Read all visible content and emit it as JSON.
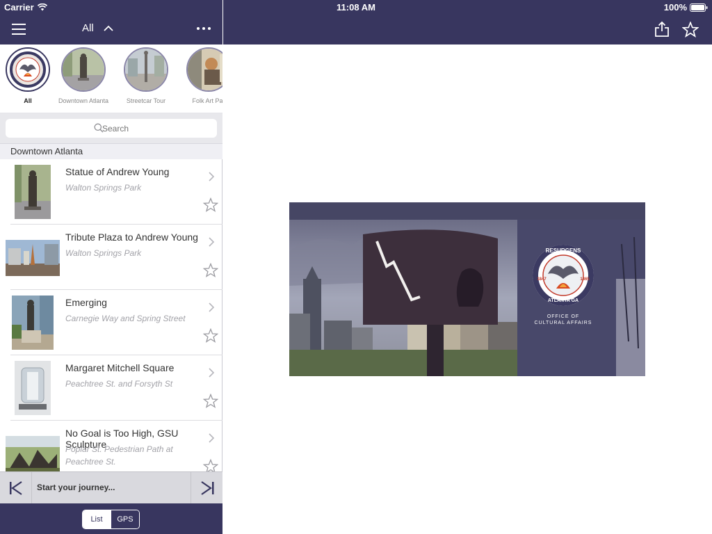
{
  "status": {
    "carrier": "Carrier",
    "time": "11:08 AM",
    "battery": "100%"
  },
  "nav": {
    "filter_label": "All"
  },
  "tours": [
    {
      "label": "All"
    },
    {
      "label": "Downtown Atlanta"
    },
    {
      "label": "Streetcar Tour"
    },
    {
      "label": "Folk Art Par"
    }
  ],
  "search": {
    "placeholder": "Search"
  },
  "section": {
    "title": "Downtown Atlanta"
  },
  "items": [
    {
      "title": "Statue of Andrew Young",
      "subtitle": "Walton Springs Park"
    },
    {
      "title": "Tribute Plaza to Andrew Young",
      "subtitle": "Walton Springs Park"
    },
    {
      "title": "Emerging",
      "subtitle": "Carnegie Way and Spring Street"
    },
    {
      "title": "Margaret Mitchell Square",
      "subtitle": "Peachtree St.  and Forsyth St"
    },
    {
      "title": "No Goal is Too High, GSU Sculpture",
      "subtitle": "Poplar St. Pedestrian Path at Peachtree St."
    }
  ],
  "journey": {
    "text": "Start your journey..."
  },
  "segmented": {
    "list": "List",
    "gps": "GPS"
  },
  "banner": {
    "seal_text": "RESURGENS",
    "seal_city": "ATLANTA GA",
    "seal_year_left": "1847",
    "seal_year_right": "1865",
    "office_line1": "OFFICE OF",
    "office_line2": "CULTURAL AFFAIRS"
  },
  "colors": {
    "nav": "#38365f",
    "accent": "#38365f"
  }
}
